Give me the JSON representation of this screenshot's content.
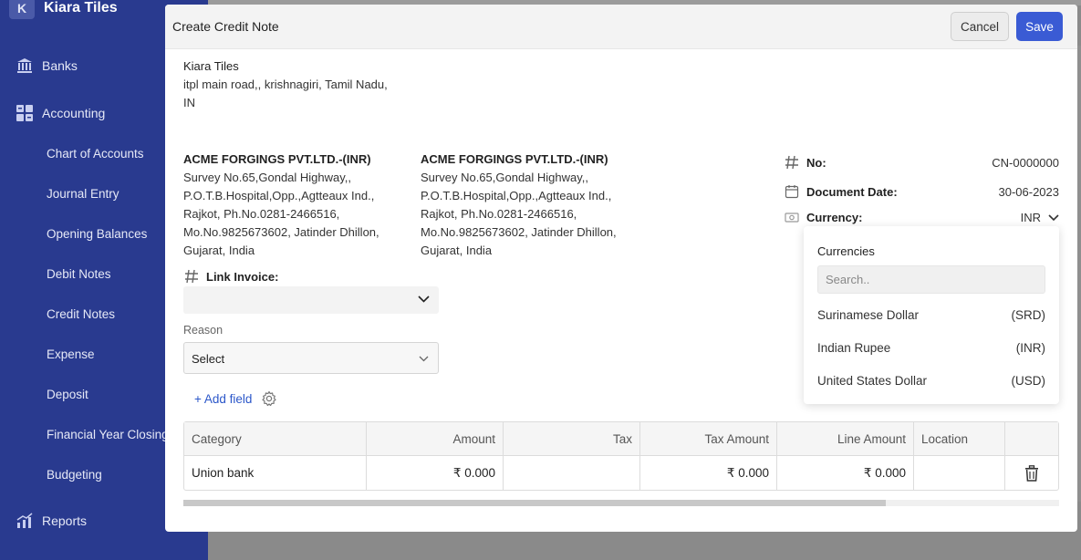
{
  "sidebar": {
    "brand_letter": "K",
    "brand_name": "Kiara Tiles",
    "banks": "Banks",
    "accounting": "Accounting",
    "items": [
      "Chart of Accounts",
      "Journal Entry",
      "Opening Balances",
      "Debit Notes",
      "Credit Notes",
      "Expense",
      "Deposit",
      "Financial Year Closing",
      "Budgeting"
    ],
    "reports": "Reports"
  },
  "modal": {
    "title": "Create Credit Note",
    "cancel_label": "Cancel",
    "save_label": "Save"
  },
  "company": {
    "name": "Kiara Tiles",
    "address_line1": "itpl main road,, krishnagiri, Tamil Nadu,",
    "address_line2": "IN"
  },
  "bill_to": {
    "name": "ACME FORGINGS PVT.LTD.-(INR)",
    "lines": [
      "Survey No.65,Gondal Highway,,",
      "P.O.T.B.Hospital,Opp.,Agtteaux Ind.,",
      "Rajkot, Ph.No.0281-2466516,",
      "Mo.No.9825673602, Jatinder Dhillon,",
      "Gujarat, India"
    ]
  },
  "ship_to": {
    "name": "ACME FORGINGS PVT.LTD.-(INR)",
    "lines": [
      "Survey No.65,Gondal Highway,,",
      "P.O.T.B.Hospital,Opp.,Agtteaux Ind.,",
      "Rajkot, Ph.No.0281-2466516,",
      "Mo.No.9825673602, Jatinder Dhillon,",
      "Gujarat, India"
    ]
  },
  "meta": {
    "no_label": "No:",
    "no_value": "CN-0000000",
    "date_label": "Document Date:",
    "date_value": "30-06-2023",
    "currency_label": "Currency:",
    "currency_value": "INR"
  },
  "form": {
    "link_invoice_label": "Link Invoice:",
    "reason_label": "Reason",
    "reason_value": "Select",
    "add_field_label": "+ Add field"
  },
  "currency_dropdown": {
    "title": "Currencies",
    "search_placeholder": "Search..",
    "options": [
      {
        "name": "Surinamese Dollar",
        "code": "(SRD)"
      },
      {
        "name": "Indian Rupee",
        "code": "(INR)"
      },
      {
        "name": "United States Dollar",
        "code": "(USD)"
      }
    ]
  },
  "table": {
    "headers": [
      "Category",
      "Amount",
      "Tax",
      "Tax Amount",
      "Line Amount",
      "Location"
    ],
    "rows": [
      {
        "category": "Union bank",
        "amount": "₹ 0.000",
        "tax": "",
        "tax_amount": "₹ 0.000",
        "line_amount": "₹ 0.000",
        "location": ""
      }
    ]
  },
  "colors": {
    "sidebar_bg": "#293a8f",
    "primary": "#3a5bd4",
    "link": "#2b57c9"
  }
}
